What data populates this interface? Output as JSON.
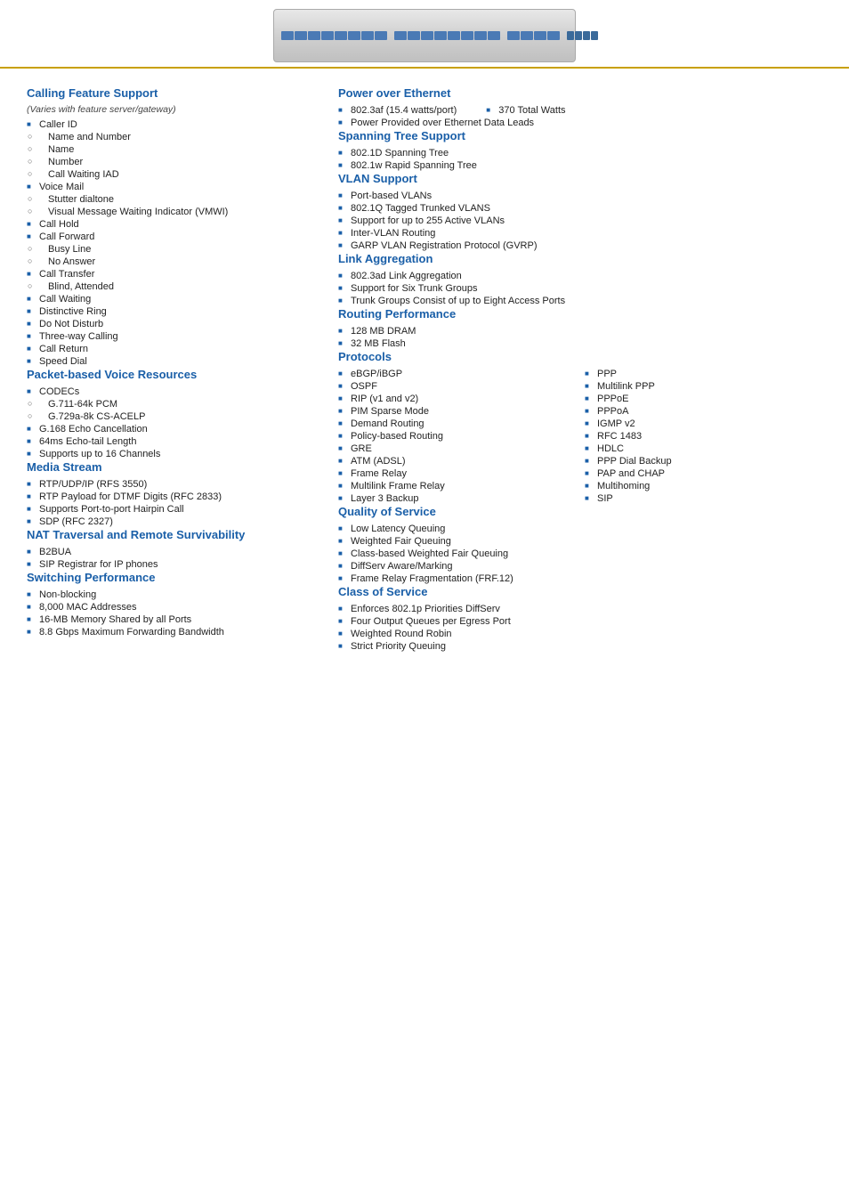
{
  "header": {
    "alt": "Network Switch Device"
  },
  "left": {
    "sections": [
      {
        "id": "calling-feature",
        "title": "Calling Feature Support",
        "subtitle": "(Varies with feature server/gateway)",
        "items": [
          {
            "text": "Caller ID",
            "type": "square"
          },
          {
            "text": "Name and Number",
            "type": "circle",
            "indent": true
          },
          {
            "text": "Name",
            "type": "circle",
            "indent": true
          },
          {
            "text": "Number",
            "type": "circle",
            "indent": true
          },
          {
            "text": "Call Waiting IAD",
            "type": "circle",
            "indent": true
          },
          {
            "text": "Voice Mail",
            "type": "square"
          },
          {
            "text": "Stutter dialtone",
            "type": "circle",
            "indent": true
          },
          {
            "text": "Visual Message Waiting Indicator (VMWI)",
            "type": "circle",
            "indent": true
          },
          {
            "text": "Call Hold",
            "type": "square"
          },
          {
            "text": "Call Forward",
            "type": "square"
          },
          {
            "text": "Busy Line",
            "type": "circle",
            "indent": true
          },
          {
            "text": "No Answer",
            "type": "circle",
            "indent": true
          },
          {
            "text": "Call Transfer",
            "type": "square"
          },
          {
            "text": "Blind, Attended",
            "type": "circle",
            "indent": true
          },
          {
            "text": "Call Waiting",
            "type": "square"
          },
          {
            "text": "Distinctive Ring",
            "type": "square"
          },
          {
            "text": "Do Not Disturb",
            "type": "square"
          },
          {
            "text": "Three-way Calling",
            "type": "square"
          },
          {
            "text": "Call Return",
            "type": "square"
          },
          {
            "text": "Speed Dial",
            "type": "square"
          }
        ]
      },
      {
        "id": "packet-voice",
        "title": "Packet-based Voice Resources",
        "items": [
          {
            "text": "CODECs",
            "type": "square"
          },
          {
            "text": "G.711-64k PCM",
            "type": "circle",
            "indent": true
          },
          {
            "text": "G.729a-8k CS-ACELP",
            "type": "circle",
            "indent": true
          },
          {
            "text": "G.168 Echo Cancellation",
            "type": "square"
          },
          {
            "text": "64ms Echo-tail Length",
            "type": "square"
          },
          {
            "text": "Supports up to 16 Channels",
            "type": "square"
          }
        ]
      },
      {
        "id": "media-stream",
        "title": "Media Stream",
        "items": [
          {
            "text": "RTP/UDP/IP (RFS 3550)",
            "type": "square"
          },
          {
            "text": "RTP Payload for DTMF Digits (RFC 2833)",
            "type": "square"
          },
          {
            "text": "Supports Port-to-port Hairpin Call",
            "type": "square"
          },
          {
            "text": "SDP (RFC 2327)",
            "type": "square"
          }
        ]
      },
      {
        "id": "nat-traversal",
        "title": "NAT Traversal and Remote Survivability",
        "items": [
          {
            "text": "B2BUA",
            "type": "square"
          },
          {
            "text": "SIP Registrar for IP phones",
            "type": "square"
          }
        ]
      },
      {
        "id": "switching",
        "title": "Switching Performance",
        "items": [
          {
            "text": "Non-blocking",
            "type": "square"
          },
          {
            "text": "8,000 MAC Addresses",
            "type": "square"
          },
          {
            "text": "16-MB Memory Shared by all Ports",
            "type": "square"
          },
          {
            "text": "8.8 Gbps Maximum Forwarding Bandwidth",
            "type": "square"
          }
        ]
      }
    ]
  },
  "right": {
    "sections": [
      {
        "id": "power-ethernet",
        "title": "Power over Ethernet",
        "items": [
          {
            "text": "802.3af (15.4 watts/port)",
            "type": "square",
            "col": 1
          },
          {
            "text": "370 Total Watts",
            "type": "square",
            "col": 2
          },
          {
            "text": "Power Provided over Ethernet Data Leads",
            "type": "square",
            "col": 0
          }
        ],
        "layout": "inline-first"
      },
      {
        "id": "spanning-tree",
        "title": "Spanning Tree Support",
        "items": [
          {
            "text": "802.1D Spanning Tree",
            "type": "square"
          },
          {
            "text": "802.1w Rapid Spanning Tree",
            "type": "square"
          }
        ]
      },
      {
        "id": "vlan-support",
        "title": "VLAN Support",
        "items": [
          {
            "text": "Port-based VLANs",
            "type": "square"
          },
          {
            "text": "802.1Q Tagged Trunked VLANS",
            "type": "square"
          },
          {
            "text": "Support for up to 255 Active VLANs",
            "type": "square"
          },
          {
            "text": "Inter-VLAN Routing",
            "type": "square"
          },
          {
            "text": "GARP VLAN Registration Protocol (GVRP)",
            "type": "square"
          }
        ]
      },
      {
        "id": "link-aggregation",
        "title": "Link Aggregation",
        "items": [
          {
            "text": "802.3ad Link Aggregation",
            "type": "square"
          },
          {
            "text": "Support for Six Trunk Groups",
            "type": "square"
          },
          {
            "text": "Trunk Groups Consist of up to Eight Access Ports",
            "type": "square"
          }
        ]
      },
      {
        "id": "routing-performance",
        "title": "Routing Performance",
        "items": [
          {
            "text": "128 MB DRAM",
            "type": "square"
          },
          {
            "text": "32 MB Flash",
            "type": "square"
          }
        ]
      },
      {
        "id": "protocols",
        "title": "Protocols",
        "col1": [
          {
            "text": "eBGP/iBGP",
            "type": "square"
          },
          {
            "text": "OSPF",
            "type": "square"
          },
          {
            "text": "RIP (v1 and v2)",
            "type": "square"
          },
          {
            "text": "PIM Sparse Mode",
            "type": "square"
          },
          {
            "text": "Demand Routing",
            "type": "square"
          },
          {
            "text": "Policy-based Routing",
            "type": "square"
          },
          {
            "text": "GRE",
            "type": "square"
          },
          {
            "text": "ATM (ADSL)",
            "type": "square"
          },
          {
            "text": "Frame Relay",
            "type": "square"
          },
          {
            "text": "Multilink Frame Relay",
            "type": "square"
          },
          {
            "text": "Layer 3 Backup",
            "type": "square"
          }
        ],
        "col2": [
          {
            "text": "PPP",
            "type": "square"
          },
          {
            "text": "Multilink PPP",
            "type": "square"
          },
          {
            "text": "PPPoE",
            "type": "square"
          },
          {
            "text": "PPPoA",
            "type": "square"
          },
          {
            "text": "IGMP v2",
            "type": "square"
          },
          {
            "text": "RFC 1483",
            "type": "square"
          },
          {
            "text": "HDLC",
            "type": "square"
          },
          {
            "text": "PPP Dial Backup",
            "type": "square"
          },
          {
            "text": "PAP and CHAP",
            "type": "square"
          },
          {
            "text": "Multihoming",
            "type": "square"
          },
          {
            "text": "SIP",
            "type": "square"
          }
        ]
      },
      {
        "id": "qos",
        "title": "Quality of Service",
        "items": [
          {
            "text": "Low Latency Queuing",
            "type": "square"
          },
          {
            "text": "Weighted Fair Queuing",
            "type": "square"
          },
          {
            "text": "Class-based Weighted Fair Queuing",
            "type": "square"
          },
          {
            "text": "DiffServ Aware/Marking",
            "type": "square"
          },
          {
            "text": "Frame Relay Fragmentation (FRF.12)",
            "type": "square"
          }
        ]
      },
      {
        "id": "class-of-service",
        "title": "Class of Service",
        "items": [
          {
            "text": "Enforces 802.1p Priorities DiffServ",
            "type": "square"
          },
          {
            "text": "Four Output Queues per Egress Port",
            "type": "square"
          },
          {
            "text": "Weighted Round Robin",
            "type": "square"
          },
          {
            "text": "Strict Priority Queuing",
            "type": "square"
          }
        ]
      }
    ]
  }
}
